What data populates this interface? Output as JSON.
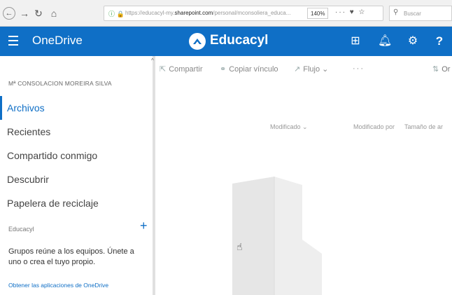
{
  "browser": {
    "url_prefix": "https://educacyl-my.",
    "url_host": "sharepoint.com",
    "url_path": "/personal/mconsoliera_educa...",
    "zoom": "140%",
    "more": "···",
    "search_placeholder": "Buscar"
  },
  "suite": {
    "app_name": "OneDrive",
    "brand": "Educacyl"
  },
  "nav": {
    "user": "Mª CONSOLACION MOREIRA SILVA",
    "items": [
      {
        "label": "Archivos"
      },
      {
        "label": "Recientes"
      },
      {
        "label": "Compartido conmigo"
      },
      {
        "label": "Descubrir"
      },
      {
        "label": "Papelera de reciclaje"
      }
    ],
    "section": "Educacyl",
    "groups_text": "Grupos reúne a los equipos. Únete a uno o crea el tuyo propio.",
    "get_apps": "Obtener las aplicaciones de OneDrive"
  },
  "commands": {
    "share": "Compartir",
    "copy_link": "Copiar vínculo",
    "flow": "Flujo",
    "more": "···",
    "sort": "Or"
  },
  "columns": {
    "modified": "Modificado",
    "modified_by": "Modificado por",
    "size": "Tamaño de ar"
  },
  "colors": {
    "suite_bar": "#0f6fc6",
    "accent": "#0f6fc6"
  }
}
